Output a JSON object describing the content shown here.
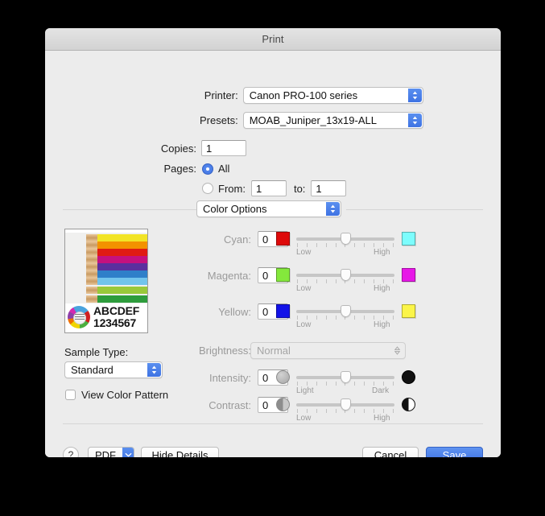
{
  "window": {
    "title": "Print"
  },
  "printer": {
    "label": "Printer:",
    "value": "Canon PRO-100 series"
  },
  "presets": {
    "label": "Presets:",
    "value": "MOAB_Juniper_13x19-ALL"
  },
  "copies": {
    "label": "Copies:",
    "value": "1"
  },
  "pages": {
    "label": "Pages:",
    "all_label": "All",
    "all_selected": true,
    "from_label": "From:",
    "from_value": "1",
    "to_label": "to:",
    "to_value": "1",
    "range_selected": false
  },
  "pane_selector": {
    "value": "Color Options"
  },
  "preview": {
    "sample_text_line1": "ABCDEF",
    "sample_text_line2": "1234567",
    "pencil_colors": [
      "#f2e426",
      "#f39200",
      "#e01b13",
      "#c5117e",
      "#5b2f9e",
      "#2f7fc9",
      "#72c4ec",
      "#9ac93a",
      "#2e9c3c"
    ],
    "wheel_colors": [
      "#4aa3dd",
      "#d02020",
      "#4caf3f",
      "#f0d400",
      "#f07000",
      "#8e3fa8",
      "#d42bb0"
    ]
  },
  "sample_type": {
    "label": "Sample Type:",
    "value": "Standard"
  },
  "view_color_pattern": {
    "label": "View Color Pattern",
    "checked": false
  },
  "color_sliders": [
    {
      "label": "Cyan:",
      "value": "0",
      "low_label": "Low",
      "high_label": "High",
      "left_swatch": "#de0a0a",
      "right_swatch": "#7dfdfd",
      "left_shape": "square",
      "right_shape": "square",
      "position_pct": 50
    },
    {
      "label": "Magenta:",
      "value": "0",
      "low_label": "Low",
      "high_label": "High",
      "left_swatch": "#84e83c",
      "right_swatch": "#e718e7",
      "left_shape": "square",
      "right_shape": "square",
      "position_pct": 50
    },
    {
      "label": "Yellow:",
      "value": "0",
      "low_label": "Low",
      "high_label": "High",
      "left_swatch": "#1313e8",
      "right_swatch": "#fbf549",
      "left_shape": "square",
      "right_shape": "square",
      "position_pct": 50
    }
  ],
  "brightness": {
    "label": "Brightness:",
    "value": "Normal",
    "disabled": true
  },
  "tone_sliders": [
    {
      "label": "Intensity:",
      "value": "0",
      "low_label": "Light",
      "high_label": "Dark",
      "left_shape": "circle-gray",
      "right_shape": "circle-black",
      "position_pct": 50
    },
    {
      "label": "Contrast:",
      "value": "0",
      "low_label": "Low",
      "high_label": "High",
      "left_shape": "circle-half-gray",
      "right_shape": "circle-half-black",
      "position_pct": 50
    }
  ],
  "footer": {
    "help_label": "?",
    "pdf_label": "PDF",
    "hide_details_label": "Hide Details",
    "cancel_label": "Cancel",
    "save_label": "Save"
  },
  "colors": {
    "accent": "#3f73e3",
    "window_bg": "#ececec",
    "titlebar_bg": "#d8d8d8",
    "desktop_bg": "#000000"
  }
}
